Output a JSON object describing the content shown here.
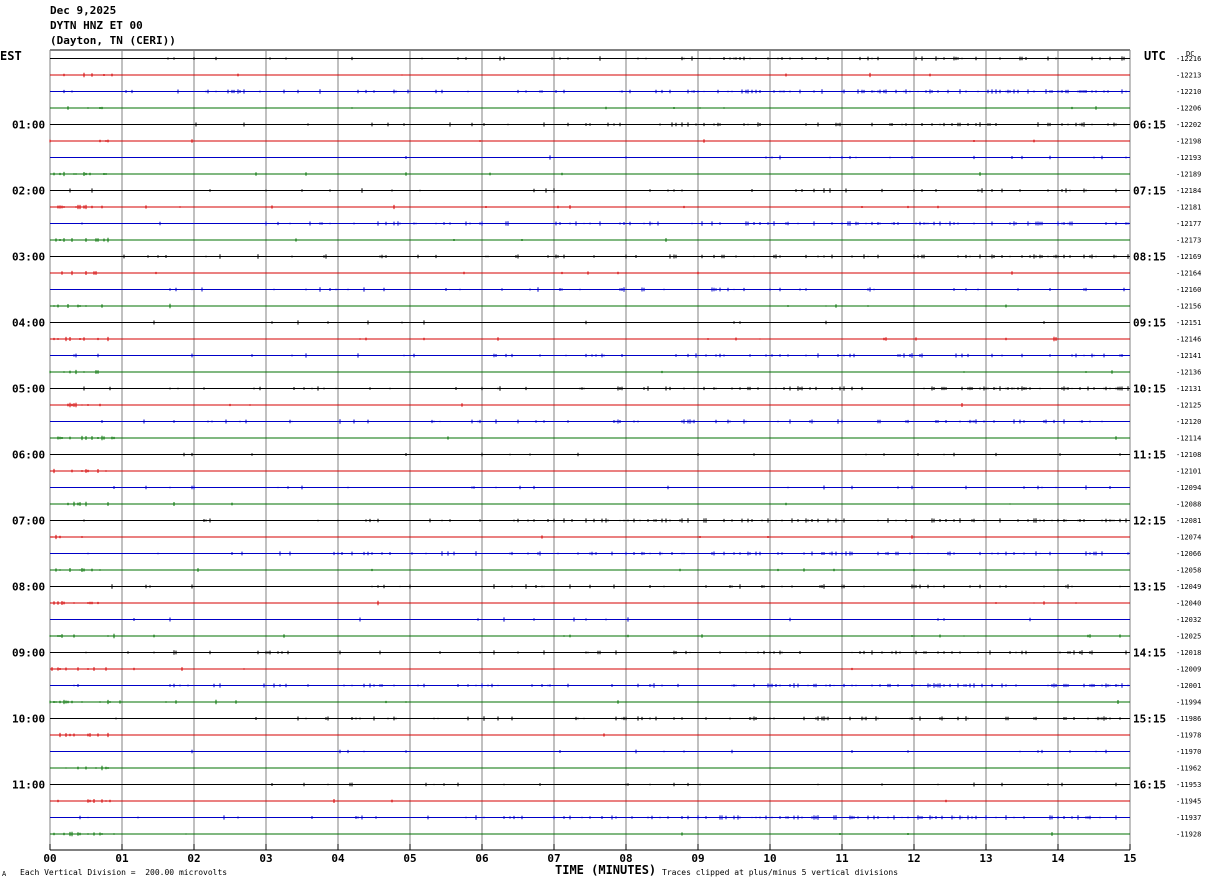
{
  "header": {
    "date": "Dec 9,2025",
    "station": "DYTN HNZ ET 00",
    "location": "(Dayton, TN (CERI))"
  },
  "left_axis_label": "EST",
  "right_axis_label": "UTC",
  "dc_label": "DC",
  "footer": {
    "scale_note": "Each Vertical Division =  200.00 microvolts",
    "clip_note": "Traces clipped at plus/minus 5 vertical divisions",
    "corner_mark": "A"
  },
  "colors": {
    "trace_cycle": [
      "#000000",
      "#d40000",
      "#0000c8",
      "#007000"
    ],
    "grid": "#808080"
  },
  "chart_data": {
    "type": "line",
    "title": "DYTN HNZ ET 00",
    "xlabel": "TIME (MINUTES)",
    "xlim": [
      0,
      15
    ],
    "x_ticks": [
      "00",
      "01",
      "02",
      "03",
      "04",
      "05",
      "06",
      "07",
      "08",
      "09",
      "10",
      "11",
      "12",
      "13",
      "14",
      "15"
    ],
    "trace_count": 48,
    "minutes_per_trace": 15,
    "est_hour_labels": [
      "01:00",
      "02:00",
      "03:00",
      "04:00",
      "05:00",
      "06:00",
      "07:00",
      "08:00",
      "09:00",
      "10:00",
      "11:00"
    ],
    "utc_labels": [
      "06:15",
      "07:15",
      "08:15",
      "09:15",
      "10:15",
      "11:15",
      "12:15",
      "13:15",
      "14:15",
      "15:15",
      "16:15"
    ],
    "dc_offsets": [
      "-12216",
      "-12213",
      "-12210",
      "-12206",
      "-12202",
      "-12198",
      "-12193",
      "-12189",
      "-12184",
      "-12181",
      "-12177",
      "-12173",
      "-12169",
      "-12164",
      "-12160",
      "-12156",
      "-12151",
      "-12146",
      "-12141",
      "-12136",
      "-12131",
      "-12125",
      "-12120",
      "-12114",
      "-12108",
      "-12101",
      "-12094",
      "-12088",
      "-12081",
      "-12074",
      "-12066",
      "-12058",
      "-12049",
      "-12040",
      "-12032",
      "-12025",
      "-12018",
      "-12009",
      "-12001",
      "-11994",
      "-11986",
      "-11978",
      "-11970",
      "-11962",
      "-11953",
      "-11945",
      "-11937",
      "-11928"
    ],
    "scale_microvolts_per_division": 200.0,
    "clip_divisions": 5
  }
}
